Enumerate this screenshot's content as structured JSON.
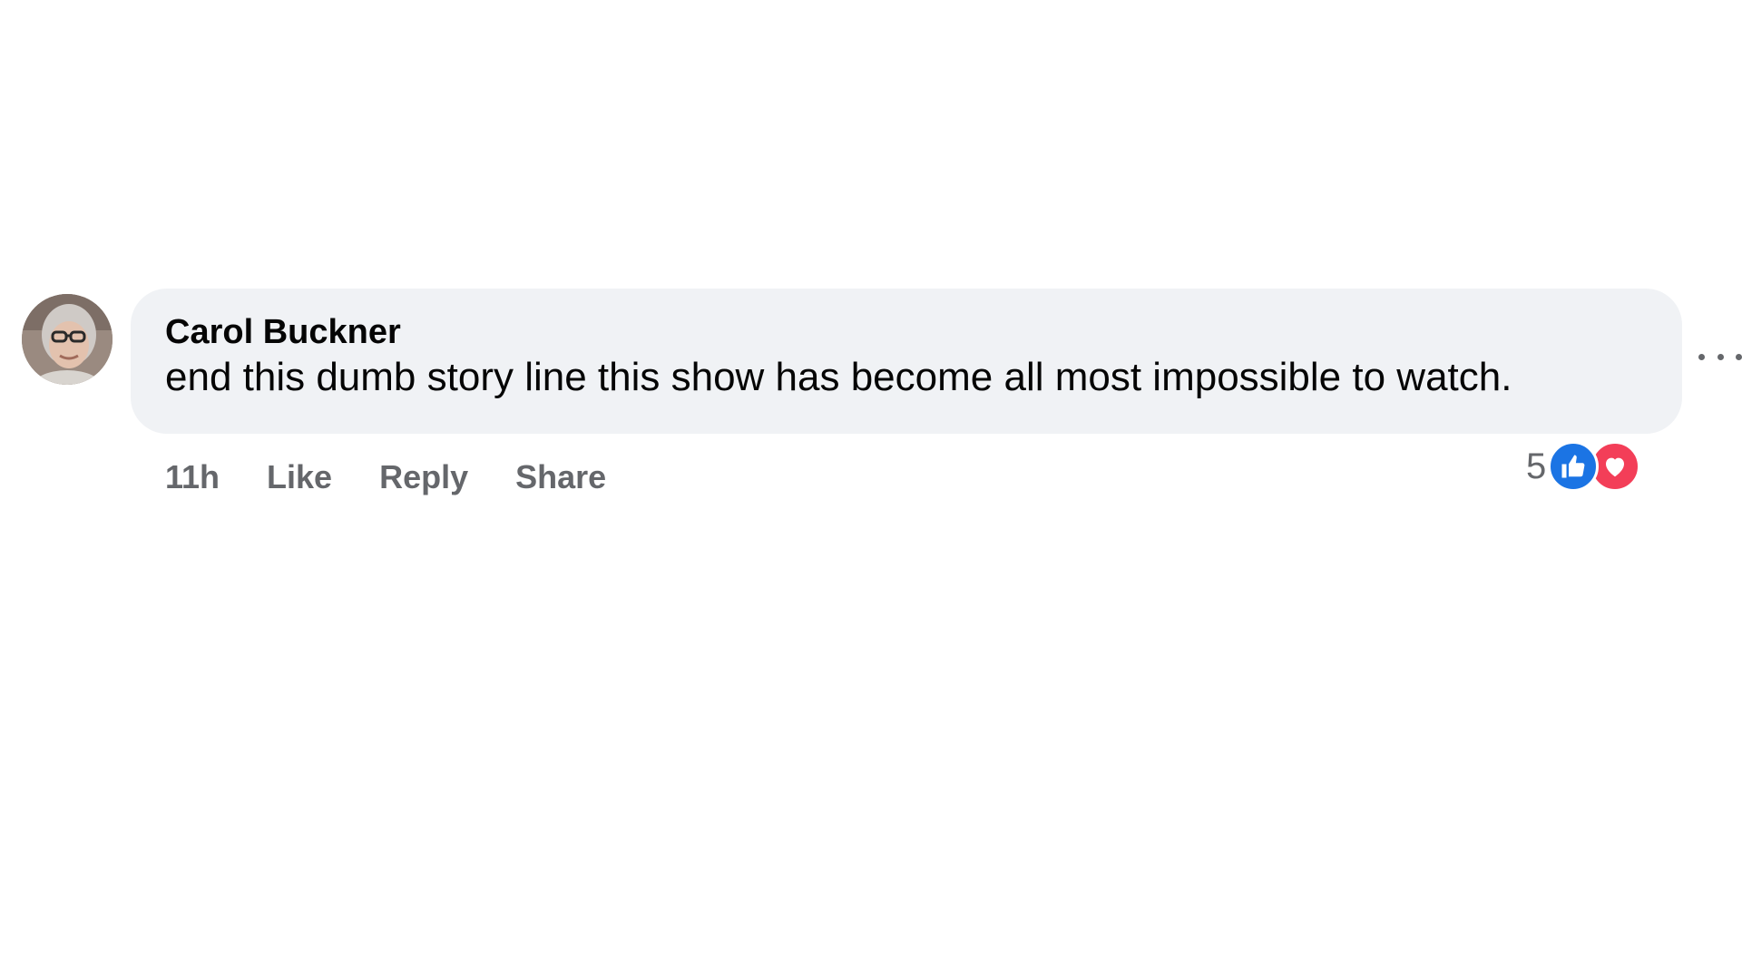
{
  "comment": {
    "author": "Carol Buckner",
    "text": "end this dumb story line this show has become all most impossible to watch.",
    "timestamp": "11h",
    "actions": {
      "like": "Like",
      "reply": "Reply",
      "share": "Share"
    },
    "reaction_count": "5",
    "reactions": [
      "like-icon",
      "love-icon"
    ]
  },
  "colors": {
    "bubble": "#f0f2f5",
    "meta_text": "#65676b",
    "like_blue": "#1b74e4",
    "love_red": "#f33e58"
  }
}
